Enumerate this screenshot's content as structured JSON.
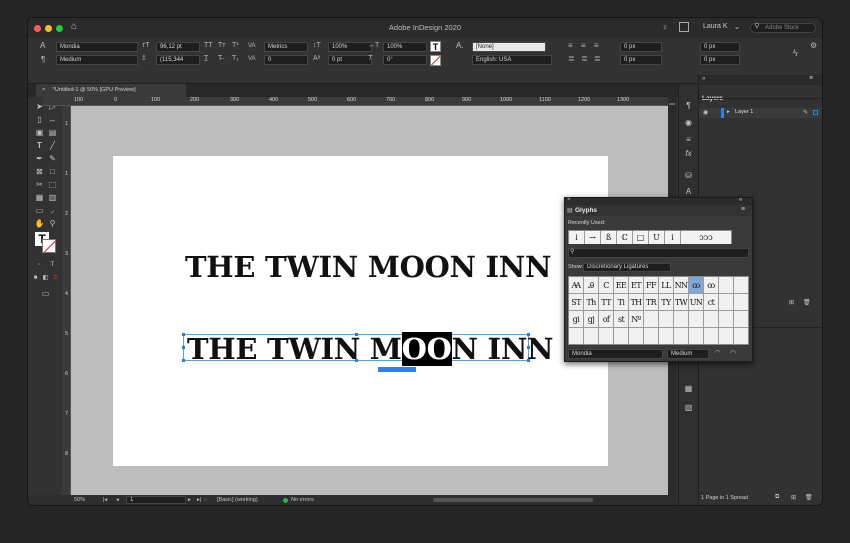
{
  "app": {
    "title": "Adobe InDesign 2020",
    "user": "Laura K",
    "search_placeholder": "Adobe Stock"
  },
  "control": {
    "font_family": "Mondia",
    "font_style": "Medium",
    "font_size": "96,12 pt",
    "leading": "(115,344",
    "kerning": "Metrics",
    "tracking": "0",
    "vscale": "100%",
    "hscale": "100%",
    "baseline": "0 pt",
    "skew": "0°",
    "char_style": "[None]",
    "language": "English: USA",
    "indent1": "0 px",
    "indent2": "0 px",
    "indent3": "0 px",
    "indent4": "0 px"
  },
  "doc_tab": {
    "close": "×",
    "label": "*Untitled-1 @ 50% [GPU Preview]"
  },
  "ruler": {
    "ticks": [
      "100",
      "0",
      "100",
      "200",
      "300",
      "400",
      "500",
      "600",
      "700",
      "800",
      "900",
      "1000",
      "1100",
      "1200",
      "1300"
    ],
    "vticks": [
      "1",
      "1",
      "2",
      "3",
      "4",
      "5",
      "6",
      "7",
      "8"
    ]
  },
  "page": {
    "headline_top": "THE TWIN MOON INN",
    "headline_before": "THE TWIN M",
    "headline_glyph": "OO",
    "headline_after": "N INN"
  },
  "status": {
    "zoom": "50%",
    "page": "1",
    "style": "[Basic] (working)",
    "errors": "No errors"
  },
  "layers": {
    "title": "Layers",
    "layer1": "Layer 1",
    "footer": "1 Page in 1 Spread"
  },
  "glyphs": {
    "title": "Glyphs",
    "recent_label": "Recently Used:",
    "recent": [
      "↓",
      "→",
      "ß",
      "ℂ",
      "□",
      "U",
      "i",
      "ↄↄↄ"
    ],
    "show_label": "Show:",
    "show_value": "Discretionary Ligatures",
    "grid": [
      [
        "Ꜳ",
        "Ꭿ",
        "Ⅽ",
        "EE",
        "ET",
        "FF",
        "LL",
        "NN",
        "ꝏ",
        "ꝏ",
        "",
        ""
      ],
      [
        "ST",
        "Th",
        "TT",
        "Ti",
        "TH",
        "TR",
        "TY",
        "TW",
        "UN",
        "ct",
        "",
        ""
      ],
      [
        "gi",
        "gj",
        "of",
        "st",
        "Nº",
        "",
        "",
        "",
        "",
        "",
        "",
        ""
      ],
      [
        "",
        "",
        "",
        "",
        "",
        "",
        "",
        "",
        "",
        "",
        "",
        ""
      ]
    ],
    "font": "Mondia",
    "style": "Medium"
  },
  "colors": {
    "accent": "#2d7ff9",
    "selection": "#5aa0e0",
    "status_ok": "#2fb54a"
  }
}
